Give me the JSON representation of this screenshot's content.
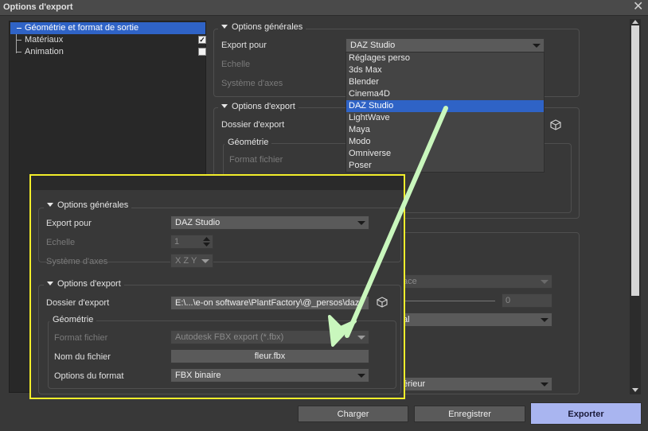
{
  "window": {
    "title": "Options d'export",
    "close_glyph": "✕"
  },
  "tree": {
    "items": [
      {
        "label": "Géométrie et format de sortie",
        "selected": true
      },
      {
        "label": "Matériaux",
        "checked": true,
        "check_glyph": "✓"
      },
      {
        "label": "Animation",
        "checked": false
      }
    ]
  },
  "general": {
    "title": "Options générales",
    "export_for_label": "Export pour",
    "export_for_value": "DAZ Studio",
    "scale_label": "Echelle",
    "scale_value": "1",
    "axes_label": "Système d'axes",
    "axes_value": "X Z Y"
  },
  "dropdown": {
    "options": [
      "Réglages perso",
      "3ds Max",
      "Blender",
      "Cinema4D",
      "DAZ Studio",
      "LightWave",
      "Maya",
      "Modo",
      "Omniverse",
      "Poser"
    ],
    "selected": "DAZ Studio"
  },
  "export": {
    "title": "Options d'export",
    "folder_label": "Dossier d'export",
    "folder_value": "E:\\...\\e-on software\\PlantFactory\\@_persos\\daz",
    "geometry_title": "Géométrie",
    "format_label": "Format fichier",
    "format_value": "Autodesk FBX export (*.fbx)",
    "filename_label": "Nom du fichier",
    "filename_value": "fleur.fbx",
    "format_options_label": "Options du format",
    "format_options_value": "FBX binaire"
  },
  "background_fragments": {
    "face": "ace",
    "zero": "0",
    "al": "al",
    "erieur": "érieur",
    "paren": ")"
  },
  "buttons": {
    "load": "Charger",
    "save": "Enregistrer",
    "export": "Exporter"
  },
  "colors": {
    "selection": "#2f63c6",
    "highlight_box": "#f2ee2a",
    "arrow": "#c9f7bd",
    "primary_button": "#a9b5f0"
  },
  "icons": {
    "folder_picker": "cube-icon"
  }
}
